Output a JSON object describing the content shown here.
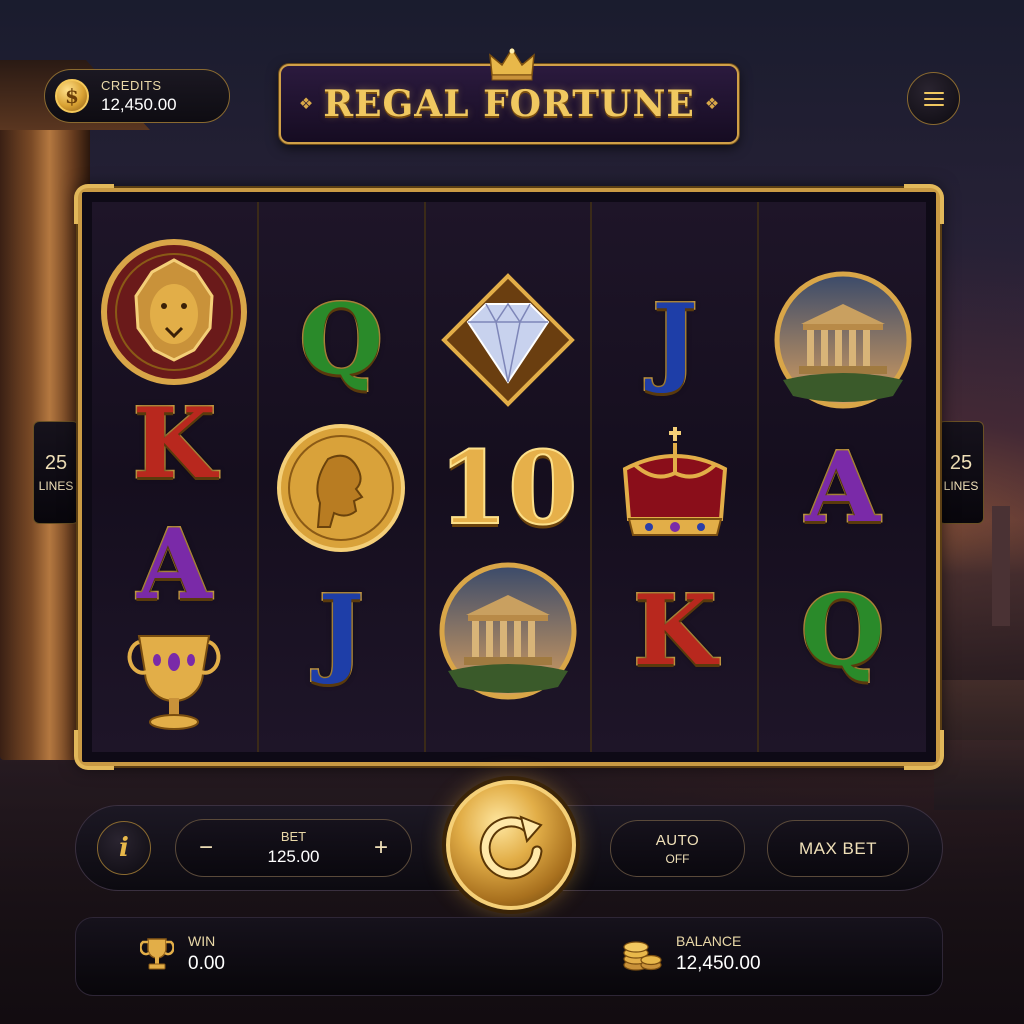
{
  "header": {
    "credits_label": "CREDITS",
    "credits_value": "12,450.00",
    "coin_symbol": "$",
    "title": "REGAL FORTUNE",
    "menu_icon": "hamburger-menu-icon"
  },
  "reels": [
    [
      "lion-medallion",
      "K",
      "A",
      "golden-chalice"
    ],
    [
      "Q",
      "coin-portrait",
      "J"
    ],
    [
      "diamond",
      "10",
      "temple-medallion"
    ],
    [
      "J",
      "crown",
      "K"
    ],
    [
      "temple-medallion",
      "A",
      "Q"
    ]
  ],
  "letter_colors": {
    "A": "#7a2aa8",
    "K": "#b8281e",
    "Q": "#2a8a2a",
    "J": "#1e3ea8"
  },
  "lines": {
    "count": "25",
    "label": "LINES"
  },
  "controls": {
    "info_label": "i",
    "bet_label": "BET",
    "bet_value": "125.00",
    "minus": "−",
    "plus": "+",
    "auto_label": "AUTO",
    "auto_state": "OFF",
    "max_bet_label": "MAX BET",
    "spin_icon": "spin-arrow-icon"
  },
  "stats": {
    "win_label": "WIN",
    "win_value": "0.00",
    "balance_label": "BALANCE",
    "balance_value": "12,450.00"
  },
  "colors": {
    "gold": "#d9a648",
    "frame": "#c99a44",
    "panel": "#0e0a16"
  }
}
